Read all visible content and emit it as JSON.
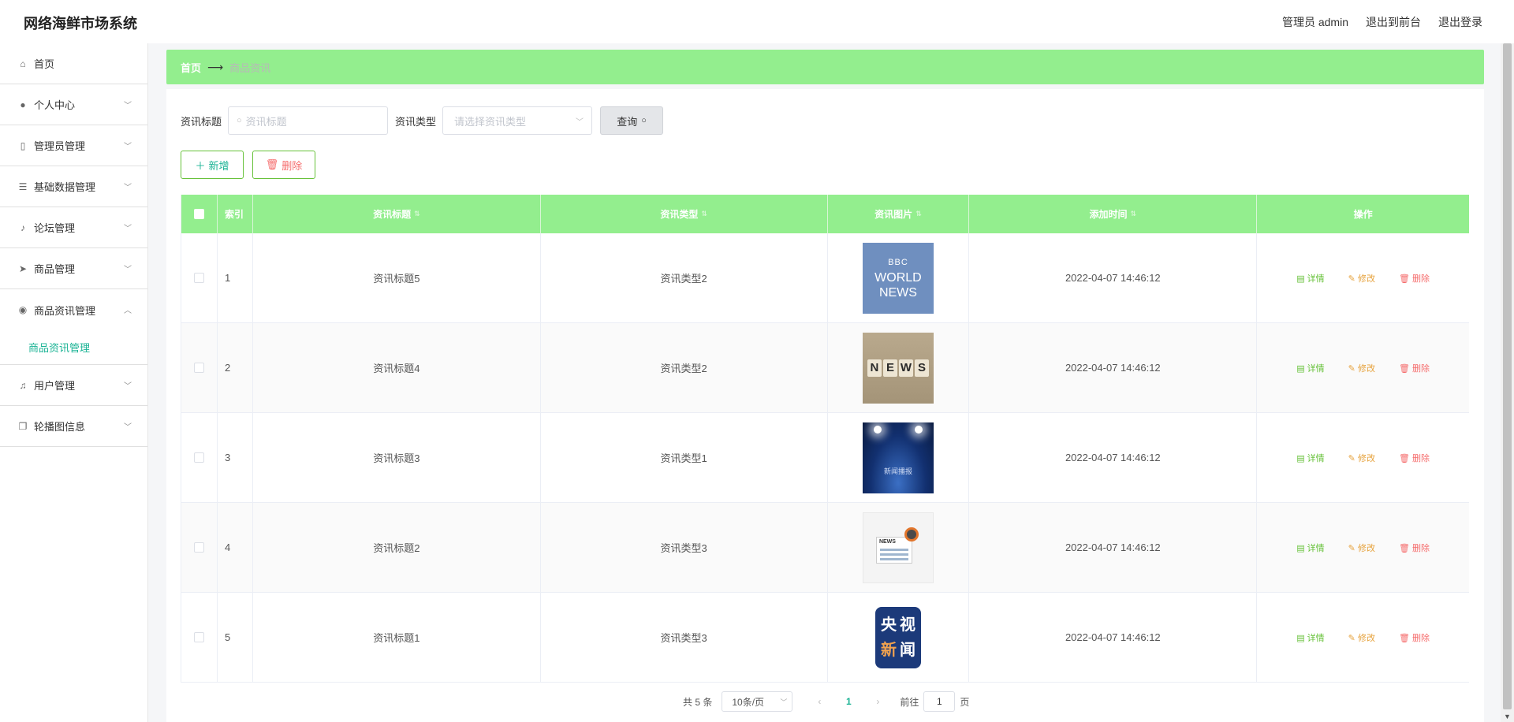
{
  "app": {
    "title": "网络海鲜市场系统"
  },
  "header": {
    "user_label": "管理员 admin",
    "front_label": "退出到前台",
    "logout_label": "退出登录"
  },
  "sidebar": {
    "items": [
      {
        "label": "首页",
        "icon": "home-icon"
      },
      {
        "label": "个人中心",
        "icon": "user-icon"
      },
      {
        "label": "管理员管理",
        "icon": "admin-icon"
      },
      {
        "label": "基础数据管理",
        "icon": "sliders-icon"
      },
      {
        "label": "论坛管理",
        "icon": "bell-off-icon"
      },
      {
        "label": "商品管理",
        "icon": "send-icon"
      },
      {
        "label": "商品资讯管理",
        "icon": "pin-icon"
      },
      {
        "label": "用户管理",
        "icon": "mic-icon"
      },
      {
        "label": "轮播图信息",
        "icon": "copy-icon"
      }
    ],
    "active_sub": "商品资讯管理"
  },
  "breadcrumb": {
    "home": "首页",
    "current": "商品资讯"
  },
  "search": {
    "title_label": "资讯标题",
    "title_placeholder": "资讯标题",
    "type_label": "资讯类型",
    "type_placeholder": "请选择资讯类型",
    "query_label": "查询"
  },
  "actions": {
    "add_label": "新增",
    "delete_label": "删除"
  },
  "table": {
    "headers": {
      "index": "索引",
      "title": "资讯标题",
      "type": "资讯类型",
      "image": "资讯图片",
      "time": "添加时间",
      "ops": "操作"
    },
    "ops": {
      "detail": "详情",
      "edit": "修改",
      "delete": "删除"
    },
    "rows": [
      {
        "index": "1",
        "title": "资讯标题5",
        "type": "资讯类型2",
        "time": "2022-04-07 14:46:12",
        "image": "BBC WORLD NEWS"
      },
      {
        "index": "2",
        "title": "资讯标题4",
        "type": "资讯类型2",
        "time": "2022-04-07 14:46:12",
        "image": "NEWS"
      },
      {
        "index": "3",
        "title": "资讯标题3",
        "type": "资讯类型1",
        "time": "2022-04-07 14:46:12",
        "image": "新闻播报"
      },
      {
        "index": "4",
        "title": "资讯标题2",
        "type": "资讯类型3",
        "time": "2022-04-07 14:46:12",
        "image": "NEWS"
      },
      {
        "index": "5",
        "title": "资讯标题1",
        "type": "资讯类型3",
        "time": "2022-04-07 14:46:12",
        "image": "央视新闻"
      }
    ]
  },
  "pagination": {
    "total": "共 5 条",
    "page_size": "10条/页",
    "current": "1",
    "goto_label": "前往",
    "goto_value": "1",
    "page_suffix": "页"
  },
  "colors": {
    "accent_green": "#93ee8e",
    "teal": "#1ab394",
    "danger": "#f56c6c",
    "warning": "#e6a23c",
    "success": "#67c23a"
  }
}
